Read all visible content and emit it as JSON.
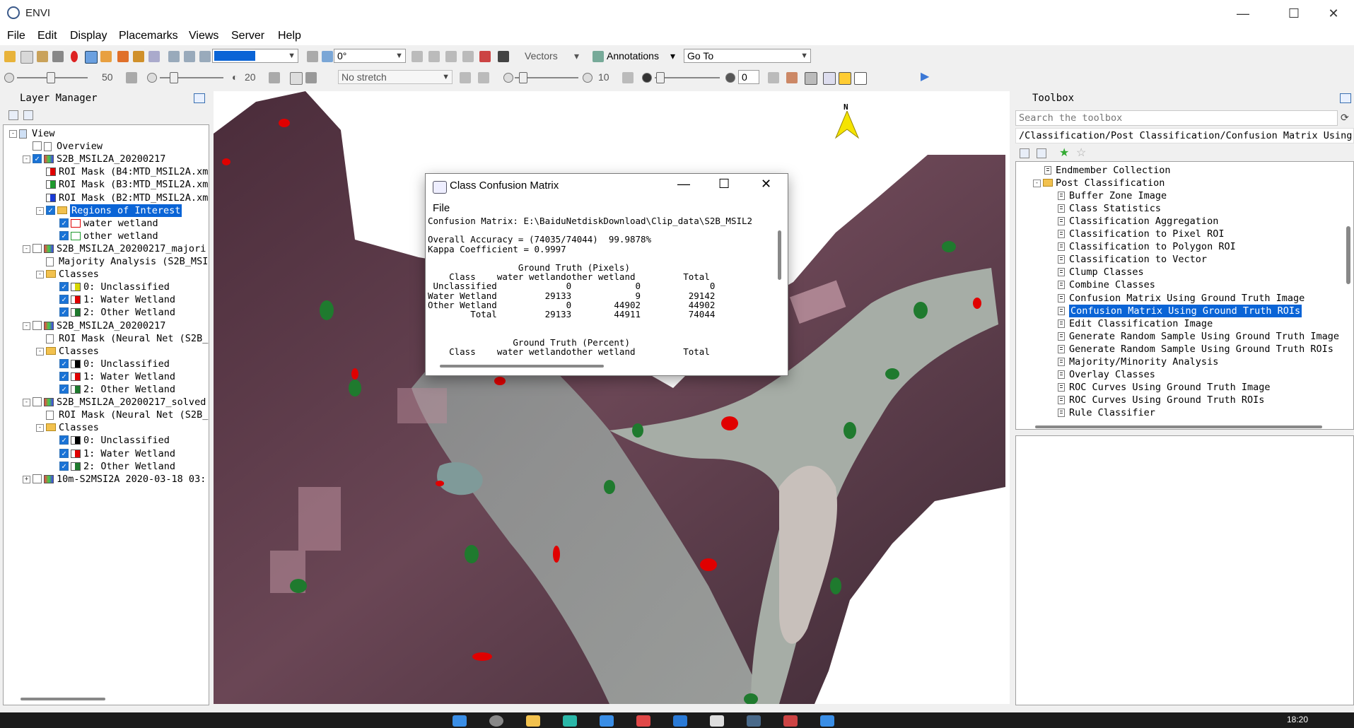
{
  "window": {
    "title": "ENVI"
  },
  "menu": [
    "File",
    "Edit",
    "Display",
    "Placemarks",
    "Views",
    "Server",
    "Help"
  ],
  "toolbar": {
    "rotation": "0°",
    "vectors": "Vectors",
    "annotations": "Annotations",
    "goto": "Go To",
    "brightness": "50",
    "contrast": "20",
    "stretch": "No stretch",
    "sharpen": "10",
    "transparency": "0"
  },
  "layer_manager": {
    "title": "Layer Manager",
    "rows": [
      "View",
      "Overview",
      "S2B_MSIL2A_20200217",
      "ROI Mask (B4:MTD_MSIL2A.xm",
      "ROI Mask (B3:MTD_MSIL2A.xm",
      "ROI Mask (B2:MTD_MSIL2A.xm",
      "Regions of Interest",
      "water wetland",
      "other wetland",
      "S2B_MSIL2A_20200217_majori",
      "Majority Analysis (S2B_MSI",
      "Classes",
      "0: Unclassified",
      "1: Water Wetland",
      "2: Other Wetland",
      "S2B_MSIL2A_20200217",
      "ROI Mask (Neural Net (S2B_",
      "Classes",
      "0: Unclassified",
      "1: Water Wetland",
      "2: Other Wetland",
      "S2B_MSIL2A_20200217_solved",
      "ROI Mask (Neural Net (S2B_",
      "Classes",
      "0: Unclassified",
      "1: Water Wetland",
      "2: Other Wetland",
      "10m-S2MSI2A 2020-03-18 03:"
    ]
  },
  "dialog": {
    "title": "Class Confusion Matrix",
    "menu_file": "File",
    "lines": [
      "Confusion Matrix: E:\\BaiduNetdiskDownload\\Clip_data\\S2B_MSIL2",
      "",
      "Overall Accuracy = (74035/74044)  99.9878%",
      "Kappa Coefficient = 0.9997",
      "",
      "                 Ground Truth (Pixels)",
      "    Class    water wetlandother wetland         Total",
      " Unclassified             0            0             0",
      "Water Wetland         29133            9         29142",
      "Other Wetland             0        44902         44902",
      "        Total         29133        44911         74044",
      "",
      "",
      "                Ground Truth (Percent)",
      "    Class    water wetlandother wetland         Total"
    ]
  },
  "toolbox": {
    "title": "Toolbox",
    "search_placeholder": "Search the toolbox",
    "path": "/Classification/Post Classification/Confusion Matrix Using",
    "items": [
      "Endmember Collection",
      "Post Classification",
      "Buffer Zone Image",
      "Class Statistics",
      "Classification Aggregation",
      "Classification to Pixel ROI",
      "Classification to Polygon ROI",
      "Classification to Vector",
      "Clump Classes",
      "Combine Classes",
      "Confusion Matrix Using Ground Truth Image",
      "Confusion Matrix Using Ground Truth ROIs",
      "Edit Classification Image",
      "Generate Random Sample Using Ground Truth Image",
      "Generate Random Sample Using Ground Truth ROIs",
      "Majority/Minority Analysis",
      "Overlay Classes",
      "ROC Curves Using Ground Truth Image",
      "ROC Curves Using Ground Truth ROIs",
      "Rule Classifier"
    ]
  },
  "compass": "N",
  "taskbar": {
    "clock": "18:20"
  },
  "colors": {
    "selection": "#0a64d6",
    "water_class": "#e00000",
    "other_class": "#1f7a2e"
  }
}
